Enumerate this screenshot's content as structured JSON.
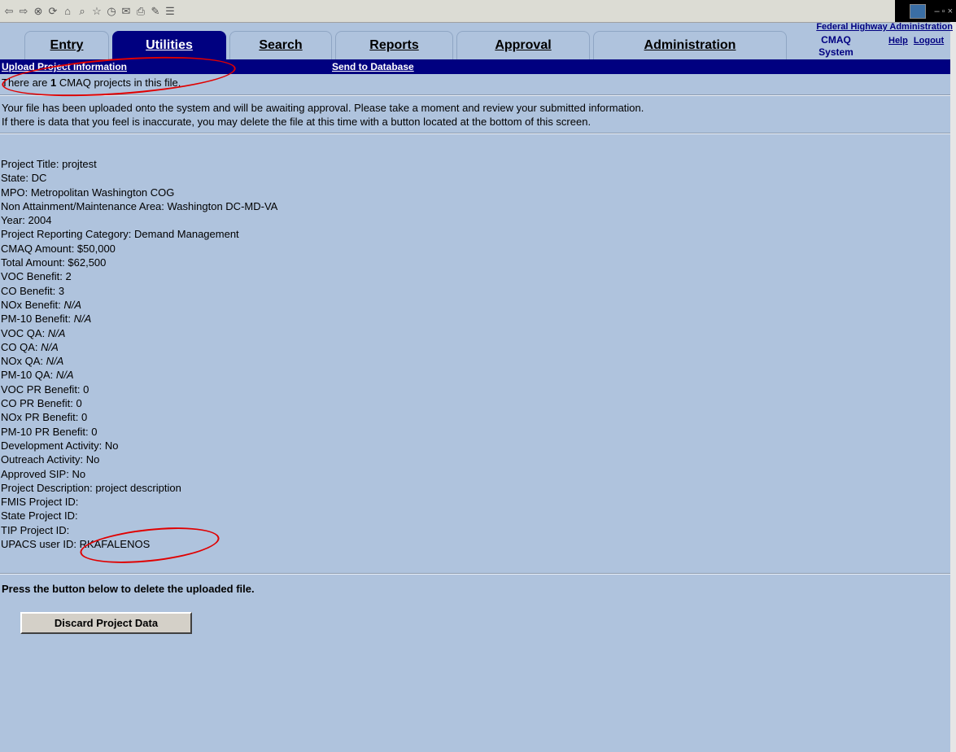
{
  "browser": {
    "toolbar_icons": [
      "back-icon",
      "forward-icon",
      "stop-icon",
      "refresh-icon",
      "home-icon",
      "search-icon",
      "favorites-icon",
      "history-icon",
      "mail-icon",
      "print-icon",
      "edit-icon",
      "discuss-icon"
    ],
    "window_controls": "– ▫ ×"
  },
  "header": {
    "agency_link": "Federal Highway Administration",
    "system_label_1": "CMAQ",
    "system_label_2": "System",
    "help": "Help",
    "logout": "Logout"
  },
  "tabs": [
    "Entry",
    "Utilities",
    "Search",
    "Reports",
    "Approval",
    "Administration"
  ],
  "active_tab": "Utilities",
  "subnav": {
    "upload": "Upload Project Information",
    "send": "Send to Database"
  },
  "summary": {
    "prefix": "There are ",
    "count": "1",
    "suffix": " CMAQ projects in this file."
  },
  "message": {
    "line1": "Your file has been uploaded onto the system and will be awaiting approval. Please take a moment and review your submitted information.",
    "line2": "If there is data that you feel is inaccurate, you may delete the file at this time with a button located at the bottom of this screen."
  },
  "fields": [
    {
      "label": "Project Title: ",
      "value": "projtest"
    },
    {
      "label": "State: ",
      "value": "DC"
    },
    {
      "label": "MPO: ",
      "value": "Metropolitan Washington COG"
    },
    {
      "label": "Non Attainment/Maintenance Area: ",
      "value": "Washington DC-MD-VA"
    },
    {
      "label": "Year: ",
      "value": "2004"
    },
    {
      "label": "Project Reporting Category: ",
      "value": "Demand Management"
    },
    {
      "label": "CMAQ Amount: ",
      "value": "$50,000"
    },
    {
      "label": "Total Amount: ",
      "value": "$62,500"
    },
    {
      "label": "VOC Benefit: ",
      "value": "2"
    },
    {
      "label": "CO Benefit: ",
      "value": "3"
    },
    {
      "label": "NOx Benefit: ",
      "value": "N/A",
      "italic": true
    },
    {
      "label": "PM-10 Benefit: ",
      "value": "N/A",
      "italic": true
    },
    {
      "label": "VOC QA: ",
      "value": "N/A",
      "italic": true
    },
    {
      "label": "CO QA: ",
      "value": "N/A",
      "italic": true
    },
    {
      "label": "NOx QA: ",
      "value": "N/A",
      "italic": true
    },
    {
      "label": "PM-10 QA: ",
      "value": "N/A",
      "italic": true
    },
    {
      "label": "VOC PR Benefit: ",
      "value": "0"
    },
    {
      "label": "CO PR Benefit: ",
      "value": "0"
    },
    {
      "label": "NOx PR Benefit: ",
      "value": "0"
    },
    {
      "label": "PM-10 PR Benefit: ",
      "value": "0"
    },
    {
      "label": "Development Activity: ",
      "value": "No"
    },
    {
      "label": "Outreach Activity: ",
      "value": "No"
    },
    {
      "label": "Approved SIP: ",
      "value": "No"
    },
    {
      "label": "Project Description: ",
      "value": "project description"
    },
    {
      "label": "FMIS Project ID: ",
      "value": ""
    },
    {
      "label": "State Project ID: ",
      "value": ""
    },
    {
      "label": "TIP Project ID: ",
      "value": ""
    },
    {
      "label": "UPACS user ID: ",
      "value": "RKAFALENOS"
    }
  ],
  "delete_prompt": "Press the button below to delete the uploaded file.",
  "discard_button": "Discard Project Data",
  "colors": {
    "page_bg": "#afc3dd",
    "nav_blue": "#000080",
    "annotation_red": "#e00000"
  }
}
